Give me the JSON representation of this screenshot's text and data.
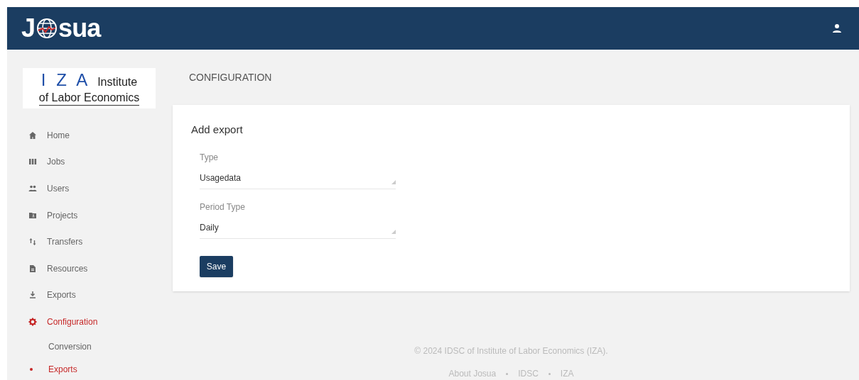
{
  "header": {
    "logo_start": "J",
    "logo_end": "sua"
  },
  "sidebar": {
    "brand": {
      "letters": "I Z A",
      "line_1": "Institute",
      "line_2": "of Labor Economics"
    },
    "items": [
      {
        "label": "Home",
        "selected": false
      },
      {
        "label": "Jobs",
        "selected": false
      },
      {
        "label": "Users",
        "selected": false
      },
      {
        "label": "Projects",
        "selected": false
      },
      {
        "label": "Transfers",
        "selected": false
      },
      {
        "label": "Resources",
        "selected": false
      },
      {
        "label": "Exports",
        "selected": false
      },
      {
        "label": "Configuration",
        "selected": true,
        "children": [
          {
            "label": "Conversion",
            "selected": false
          },
          {
            "label": "Exports",
            "selected": true
          }
        ]
      }
    ]
  },
  "page_title": "CONFIGURATION",
  "card": {
    "title": "Add export",
    "fields": [
      {
        "label": "Type",
        "value": "Usagedata"
      },
      {
        "label": "Period Type",
        "value": "Daily"
      }
    ],
    "button": "Save"
  },
  "footer": {
    "copyright": "© 2024 IDSC of Institute of Labor Economics (IZA).",
    "links": [
      "About Josua",
      "IDSC",
      "IZA"
    ]
  }
}
